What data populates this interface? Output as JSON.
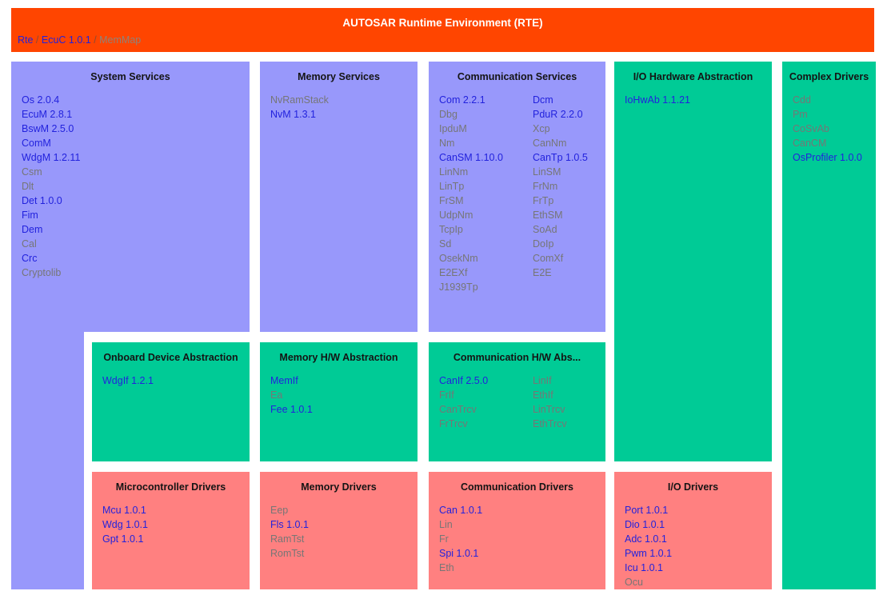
{
  "header": {
    "title": "AUTOSAR Runtime Environment (RTE)",
    "separator": "/",
    "breadcrumb": [
      {
        "label": "Rte",
        "linked": true
      },
      {
        "label": "EcuC 1.0.1",
        "linked": true
      },
      {
        "label": "MemMap",
        "linked": false
      }
    ]
  },
  "colors": {
    "header_bg": "#FF4500",
    "service_bg": "#9898FB",
    "abstraction_bg": "#00CB96",
    "driver_bg": "#FF8080",
    "link_text": "#2222DD",
    "muted_text": "#767676",
    "title_text": "#141414",
    "header_title_text": "#FFFFFF"
  },
  "blocks": {
    "system_services": {
      "title": "System Services",
      "items": [
        {
          "label": "Os 2.0.4",
          "linked": true
        },
        {
          "label": "EcuM 2.8.1",
          "linked": true
        },
        {
          "label": "BswM 2.5.0",
          "linked": true
        },
        {
          "label": "ComM",
          "linked": true
        },
        {
          "label": "WdgM 1.2.11",
          "linked": true
        },
        {
          "label": "Csm",
          "linked": false
        },
        {
          "label": "Dlt",
          "linked": false
        },
        {
          "label": "Det 1.0.0",
          "linked": true
        },
        {
          "label": "Fim",
          "linked": true
        },
        {
          "label": "Dem",
          "linked": true
        },
        {
          "label": "Cal",
          "linked": false
        },
        {
          "label": "Crc",
          "linked": true
        },
        {
          "label": "Cryptolib",
          "linked": false
        }
      ]
    },
    "memory_services": {
      "title": "Memory Services",
      "items": [
        {
          "label": "NvRamStack",
          "linked": false
        },
        {
          "label": "NvM 1.3.1",
          "linked": true
        }
      ]
    },
    "communication_services": {
      "title": "Communication Services",
      "col1": [
        {
          "label": "Com 2.2.1",
          "linked": true
        },
        {
          "label": "Dbg",
          "linked": false
        },
        {
          "label": "IpduM",
          "linked": false
        },
        {
          "label": "Nm",
          "linked": false
        },
        {
          "label": "CanSM 1.10.0",
          "linked": true
        },
        {
          "label": "LinNm",
          "linked": false
        },
        {
          "label": "LinTp",
          "linked": false
        },
        {
          "label": "FrSM",
          "linked": false
        },
        {
          "label": "UdpNm",
          "linked": false
        },
        {
          "label": "TcpIp",
          "linked": false
        },
        {
          "label": "Sd",
          "linked": false
        },
        {
          "label": "OsekNm",
          "linked": false
        },
        {
          "label": "E2EXf",
          "linked": false
        },
        {
          "label": "J1939Tp",
          "linked": false
        }
      ],
      "col2": [
        {
          "label": "Dcm",
          "linked": true
        },
        {
          "label": "PduR 2.2.0",
          "linked": true
        },
        {
          "label": "Xcp",
          "linked": false
        },
        {
          "label": "CanNm",
          "linked": false
        },
        {
          "label": "CanTp 1.0.5",
          "linked": true
        },
        {
          "label": "LinSM",
          "linked": false
        },
        {
          "label": "FrNm",
          "linked": false
        },
        {
          "label": "FrTp",
          "linked": false
        },
        {
          "label": "EthSM",
          "linked": false
        },
        {
          "label": "SoAd",
          "linked": false
        },
        {
          "label": "DoIp",
          "linked": false
        },
        {
          "label": "ComXf",
          "linked": false
        },
        {
          "label": "E2E",
          "linked": false
        }
      ]
    },
    "io_hw_abstraction": {
      "title": "I/O Hardware Abstraction",
      "items": [
        {
          "label": "IoHwAb 1.1.21",
          "linked": true
        }
      ]
    },
    "complex_drivers": {
      "title": "Complex Drivers",
      "items": [
        {
          "label": "Cdd",
          "linked": false
        },
        {
          "label": "Pm",
          "linked": false
        },
        {
          "label": "CoSvAb",
          "linked": false
        },
        {
          "label": "CanCM",
          "linked": false
        },
        {
          "label": "OsProfiler 1.0.0",
          "linked": true
        }
      ]
    },
    "onboard_device_abstraction": {
      "title": "Onboard Device Abstraction",
      "items": [
        {
          "label": "WdgIf 1.2.1",
          "linked": true
        }
      ]
    },
    "memory_hw_abstraction": {
      "title": "Memory H/W Abstraction",
      "items": [
        {
          "label": "MemIf",
          "linked": true
        },
        {
          "label": "Ea",
          "linked": false
        },
        {
          "label": "Fee 1.0.1",
          "linked": true
        }
      ]
    },
    "communication_hw_abstraction": {
      "title": "Communication H/W Abs...",
      "col1": [
        {
          "label": "CanIf 2.5.0",
          "linked": true
        },
        {
          "label": "FrIf",
          "linked": false
        },
        {
          "label": "CanTrcv",
          "linked": false
        },
        {
          "label": "FrTrcv",
          "linked": false
        }
      ],
      "col2": [
        {
          "label": "LinIf",
          "linked": false
        },
        {
          "label": "EthIf",
          "linked": false
        },
        {
          "label": "LinTrcv",
          "linked": false
        },
        {
          "label": "EthTrcv",
          "linked": false
        }
      ]
    },
    "microcontroller_drivers": {
      "title": "Microcontroller Drivers",
      "items": [
        {
          "label": "Mcu 1.0.1",
          "linked": true
        },
        {
          "label": "Wdg 1.0.1",
          "linked": true
        },
        {
          "label": "Gpt 1.0.1",
          "linked": true
        }
      ]
    },
    "memory_drivers": {
      "title": "Memory Drivers",
      "items": [
        {
          "label": "Eep",
          "linked": false
        },
        {
          "label": "Fls 1.0.1",
          "linked": true
        },
        {
          "label": "RamTst",
          "linked": false
        },
        {
          "label": "RomTst",
          "linked": false
        }
      ]
    },
    "communication_drivers": {
      "title": "Communication Drivers",
      "items": [
        {
          "label": "Can 1.0.1",
          "linked": true
        },
        {
          "label": "Lin",
          "linked": false
        },
        {
          "label": "Fr",
          "linked": false
        },
        {
          "label": "Spi 1.0.1",
          "linked": true
        },
        {
          "label": "Eth",
          "linked": false
        }
      ]
    },
    "io_drivers": {
      "title": "I/O Drivers",
      "items": [
        {
          "label": "Port 1.0.1",
          "linked": true
        },
        {
          "label": "Dio 1.0.1",
          "linked": true
        },
        {
          "label": "Adc 1.0.1",
          "linked": true
        },
        {
          "label": "Pwm 1.0.1",
          "linked": true
        },
        {
          "label": "Icu 1.0.1",
          "linked": true
        },
        {
          "label": "Ocu",
          "linked": false
        }
      ]
    }
  }
}
